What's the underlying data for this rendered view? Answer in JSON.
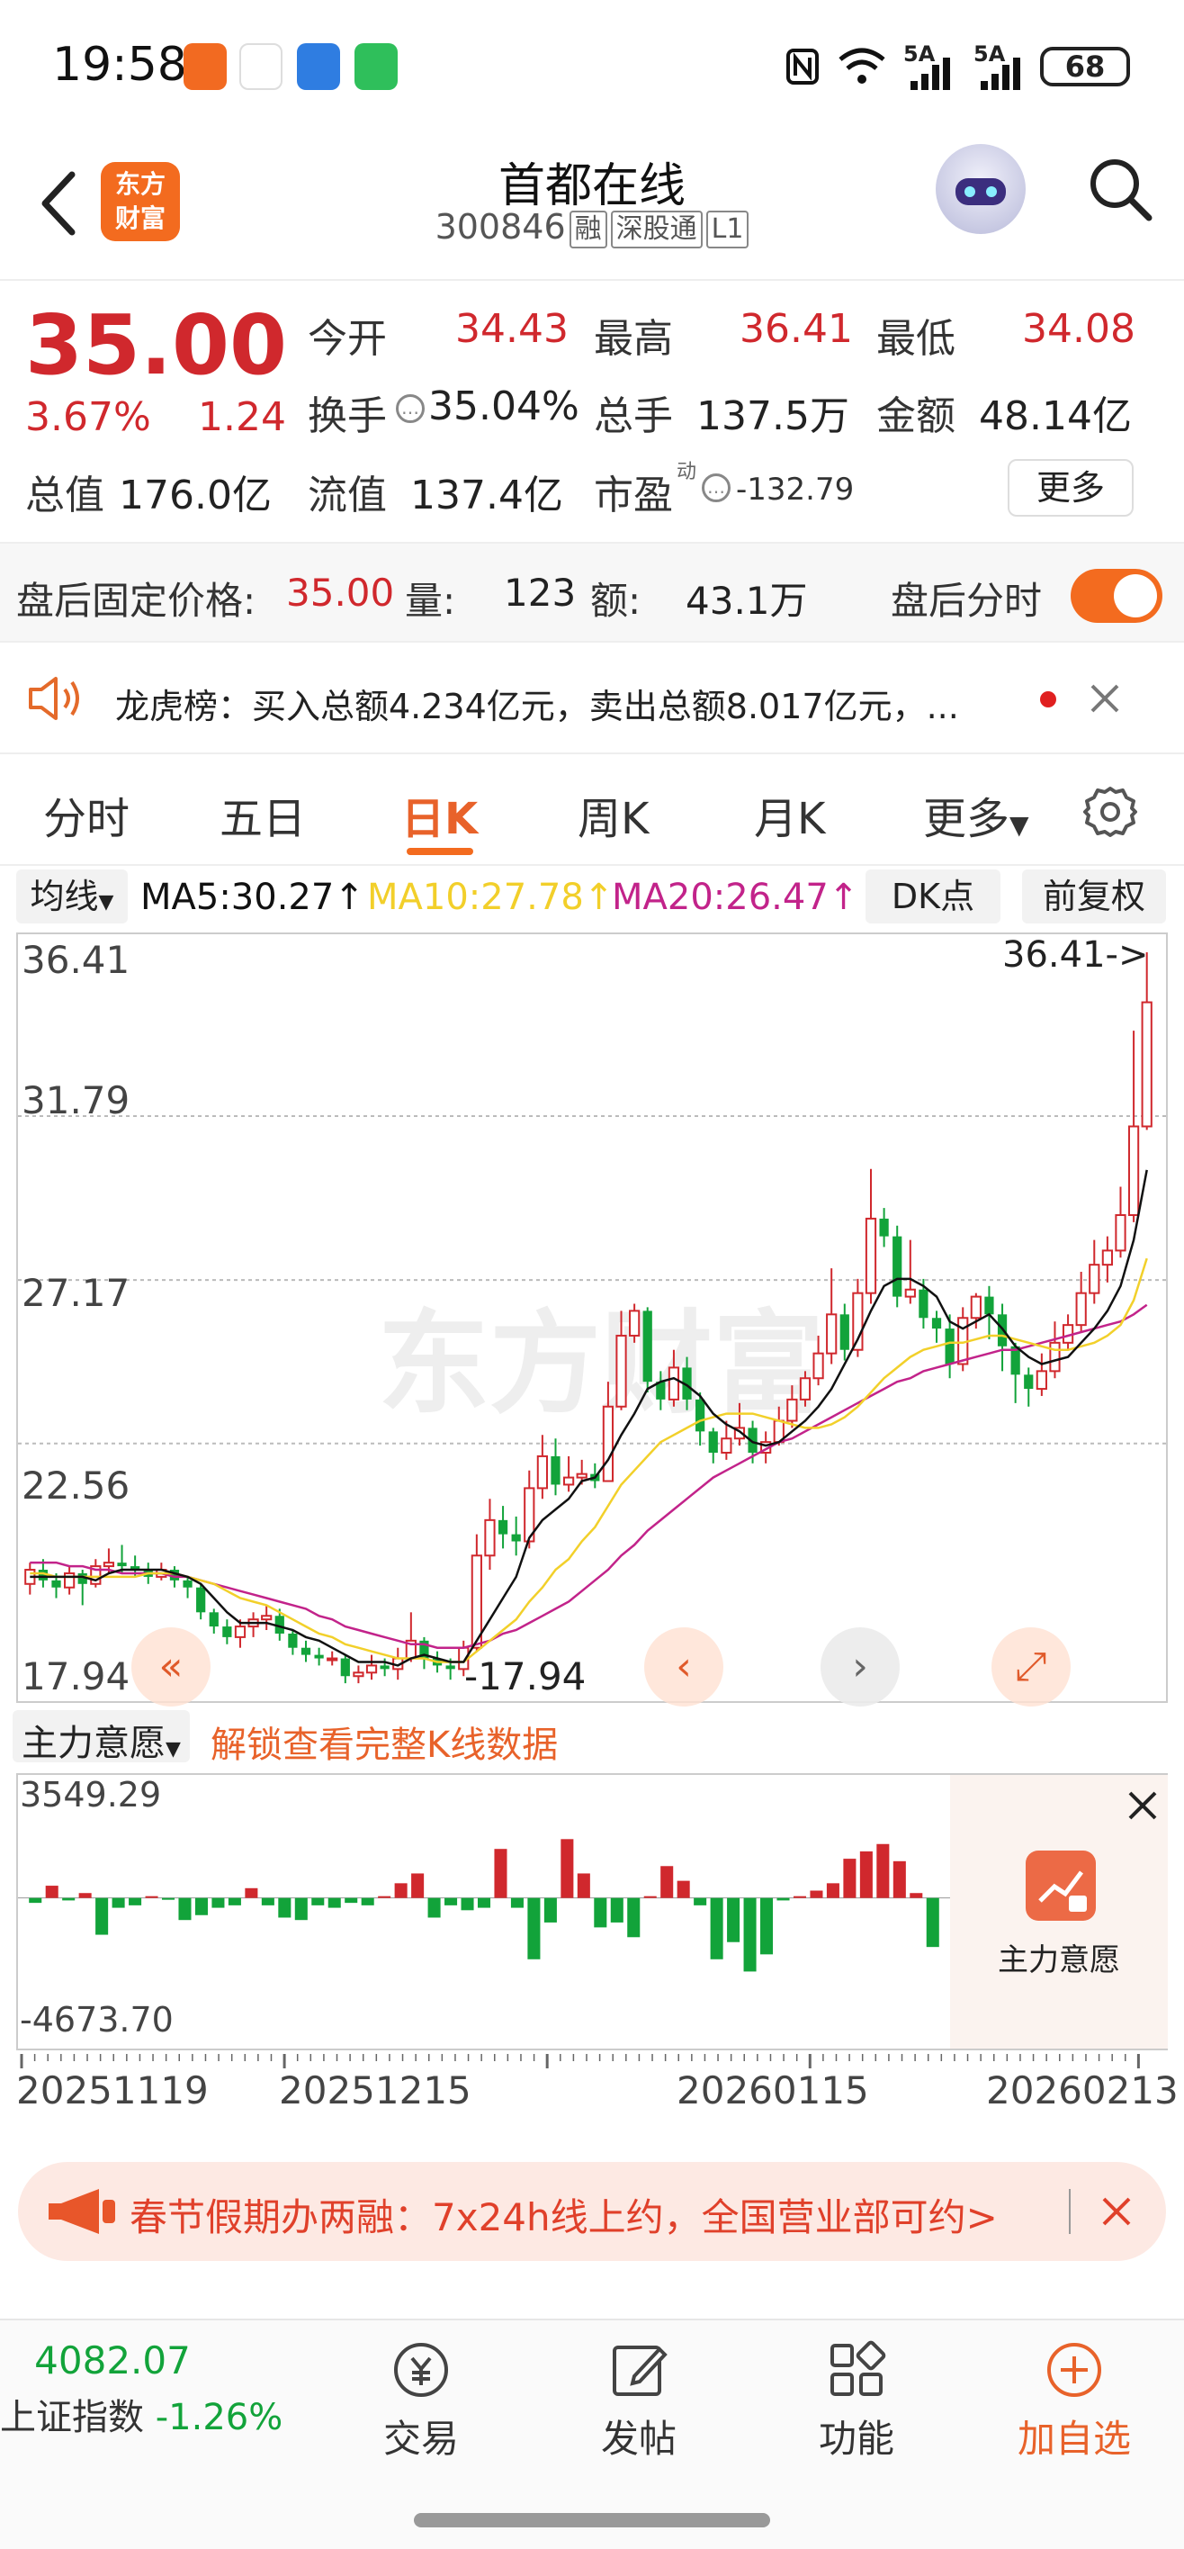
{
  "status": {
    "time": "19:58",
    "network": "5A",
    "battery": "68"
  },
  "header": {
    "logo_line1": "东方",
    "logo_line2": "财富",
    "name": "首都在线",
    "code": "300846",
    "tags": [
      "融",
      "深股通",
      "L1"
    ]
  },
  "quote": {
    "price": "35.00",
    "change_pct": "3.67%",
    "change_amt": "1.24",
    "open_label": "今开",
    "open": "34.43",
    "high_label": "最高",
    "high": "36.41",
    "low_label": "最低",
    "low": "34.08",
    "turnover_label": "换手",
    "turnover": "35.04%",
    "volume_label": "总手",
    "volume": "137.5万",
    "amount_label": "金额",
    "amount": "48.14亿",
    "mcap_label": "总值",
    "mcap": "176.0亿",
    "float_label": "流值",
    "float": "137.4亿",
    "pe_label": "市盈",
    "pe_sup": "动",
    "pe": "-132.79",
    "more_label": "更多"
  },
  "afterhours": {
    "price_label": "盘后固定价格:",
    "price": "35.00",
    "vol_label": "量:",
    "vol": "123",
    "amt_label": "额:",
    "amt": "43.1万",
    "toggle_label": "盘后分时",
    "toggle_on": true
  },
  "notice": {
    "text": "龙虎榜：买入总额4.234亿元，卖出总额8.017亿元，..."
  },
  "tabs": [
    "分时",
    "五日",
    "日K",
    "周K",
    "月K",
    "更多"
  ],
  "active_tab": "日K",
  "ma": {
    "selector": "均线",
    "ma5": "MA5:30.27↑",
    "ma10": "MA10:27.78↑",
    "ma20": "MA20:26.47↑",
    "dk": "DK点",
    "adjust": "前复权",
    "ma5_color": "#111111",
    "ma10_color": "#f2d02a",
    "ma20_color": "#c2238a"
  },
  "kline": {
    "price_labels": [
      "36.41",
      "31.79",
      "27.17",
      "22.56",
      "17.94"
    ],
    "high_marker": "36.41->",
    "low_marker": "-17.94",
    "watermark": "东方财富",
    "up_color": "#d0282d",
    "down_color": "#12a33a",
    "bars": [
      [
        18.6,
        19.0,
        18.3,
        19.2
      ],
      [
        19.0,
        18.7,
        18.5,
        19.3
      ],
      [
        18.7,
        18.5,
        18.2,
        18.9
      ],
      [
        18.5,
        18.9,
        18.3,
        19.1
      ],
      [
        18.9,
        18.6,
        18.0,
        19.0
      ],
      [
        18.6,
        19.1,
        18.5,
        19.3
      ],
      [
        19.1,
        19.2,
        18.9,
        19.6
      ],
      [
        19.2,
        19.1,
        18.9,
        19.7
      ],
      [
        19.1,
        19.0,
        18.8,
        19.4
      ],
      [
        19.0,
        18.8,
        18.6,
        19.2
      ],
      [
        18.8,
        19.0,
        18.7,
        19.2
      ],
      [
        19.0,
        18.7,
        18.5,
        19.1
      ],
      [
        18.7,
        18.5,
        18.2,
        18.8
      ],
      [
        18.5,
        17.8,
        17.6,
        18.6
      ],
      [
        17.8,
        17.4,
        17.2,
        17.9
      ],
      [
        17.4,
        17.1,
        16.9,
        17.6
      ],
      [
        17.1,
        17.4,
        16.8,
        17.6
      ],
      [
        17.4,
        17.6,
        17.1,
        17.8
      ],
      [
        17.6,
        17.7,
        17.3,
        18.0
      ],
      [
        17.7,
        17.2,
        17.0,
        17.9
      ],
      [
        17.2,
        16.8,
        16.6,
        17.3
      ],
      [
        16.8,
        16.6,
        16.4,
        17.0
      ],
      [
        16.6,
        16.5,
        16.3,
        16.8
      ],
      [
        16.5,
        16.5,
        16.3,
        16.7
      ],
      [
        16.5,
        16.0,
        15.8,
        16.6
      ],
      [
        16.0,
        16.1,
        15.8,
        16.3
      ],
      [
        16.1,
        16.3,
        15.9,
        16.6
      ],
      [
        16.3,
        16.2,
        16.0,
        16.5
      ],
      [
        16.2,
        16.5,
        15.9,
        16.8
      ],
      [
        16.5,
        17.0,
        16.4,
        17.8
      ],
      [
        17.0,
        16.5,
        16.2,
        17.1
      ],
      [
        16.5,
        16.3,
        16.1,
        16.7
      ],
      [
        16.3,
        16.2,
        15.9,
        16.5
      ],
      [
        16.2,
        16.8,
        16.0,
        17.0
      ],
      [
        16.8,
        19.4,
        16.7,
        20.0
      ],
      [
        19.4,
        20.4,
        19.0,
        21.0
      ],
      [
        20.4,
        20.0,
        19.6,
        20.8
      ],
      [
        20.0,
        19.8,
        19.4,
        20.5
      ],
      [
        19.8,
        21.3,
        19.6,
        21.8
      ],
      [
        21.3,
        22.2,
        21.0,
        22.8
      ],
      [
        22.2,
        21.4,
        21.1,
        22.7
      ],
      [
        21.4,
        21.6,
        21.2,
        22.2
      ],
      [
        21.6,
        21.7,
        21.4,
        22.1
      ],
      [
        21.7,
        21.5,
        21.3,
        22.0
      ],
      [
        21.5,
        23.6,
        21.5,
        24.3
      ],
      [
        23.6,
        25.6,
        23.5,
        26.3
      ],
      [
        25.6,
        26.3,
        25.4,
        26.5
      ],
      [
        26.3,
        24.3,
        24.0,
        26.4
      ],
      [
        24.3,
        23.8,
        23.5,
        24.6
      ],
      [
        23.8,
        24.7,
        23.6,
        25.2
      ],
      [
        24.7,
        23.8,
        23.5,
        25.0
      ],
      [
        23.8,
        22.9,
        22.5,
        24.0
      ],
      [
        22.9,
        22.3,
        22.0,
        23.0
      ],
      [
        22.3,
        22.7,
        22.1,
        23.2
      ],
      [
        22.7,
        23.0,
        22.5,
        23.7
      ],
      [
        23.0,
        22.3,
        22.0,
        23.2
      ],
      [
        22.3,
        22.6,
        22.0,
        22.9
      ],
      [
        22.6,
        23.2,
        22.5,
        23.6
      ],
      [
        23.2,
        23.8,
        23.0,
        24.2
      ],
      [
        23.8,
        24.4,
        23.6,
        24.6
      ],
      [
        24.4,
        25.1,
        24.2,
        25.6
      ],
      [
        25.1,
        26.2,
        24.8,
        27.5
      ],
      [
        26.2,
        25.2,
        24.9,
        26.5
      ],
      [
        25.2,
        26.8,
        25.0,
        27.2
      ],
      [
        26.8,
        28.9,
        26.5,
        30.3
      ],
      [
        28.9,
        28.4,
        28.1,
        29.2
      ],
      [
        28.4,
        26.7,
        26.4,
        28.7
      ],
      [
        26.7,
        26.9,
        26.5,
        28.3
      ],
      [
        26.9,
        26.1,
        25.8,
        27.2
      ],
      [
        26.1,
        25.8,
        25.4,
        26.3
      ],
      [
        25.8,
        24.8,
        24.4,
        26.2
      ],
      [
        24.8,
        26.1,
        24.6,
        26.4
      ],
      [
        26.1,
        26.7,
        25.8,
        26.8
      ],
      [
        26.7,
        26.2,
        25.5,
        27.0
      ],
      [
        26.2,
        25.3,
        24.6,
        26.5
      ],
      [
        25.3,
        24.5,
        23.7,
        25.4
      ],
      [
        24.5,
        24.1,
        23.6,
        24.7
      ],
      [
        24.1,
        24.6,
        23.9,
        25.1
      ],
      [
        24.6,
        25.4,
        24.4,
        26.0
      ],
      [
        25.4,
        25.9,
        25.2,
        26.2
      ],
      [
        25.9,
        26.8,
        25.7,
        27.4
      ],
      [
        26.8,
        27.6,
        26.5,
        28.3
      ],
      [
        27.6,
        28.0,
        27.1,
        28.4
      ],
      [
        28.0,
        29.0,
        27.8,
        29.8
      ],
      [
        29.0,
        31.5,
        28.8,
        34.2
      ],
      [
        31.5,
        35.0,
        31.4,
        36.41
      ]
    ],
    "ma5": [
      18.8,
      18.8,
      18.8,
      18.8,
      18.8,
      18.7,
      18.9,
      19.0,
      19.0,
      19.0,
      19.0,
      18.9,
      18.8,
      18.6,
      18.2,
      17.8,
      17.5,
      17.5,
      17.5,
      17.4,
      17.3,
      17.1,
      17.0,
      16.8,
      16.6,
      16.4,
      16.4,
      16.4,
      16.3,
      16.5,
      16.6,
      16.5,
      16.4,
      16.4,
      17.0,
      17.6,
      18.2,
      18.8,
      19.9,
      20.4,
      20.7,
      21.0,
      21.5,
      21.6,
      22.1,
      22.8,
      23.4,
      24.1,
      24.3,
      24.4,
      24.2,
      23.9,
      23.4,
      23.1,
      22.9,
      22.6,
      22.5,
      22.6,
      22.9,
      23.2,
      23.6,
      24.1,
      24.8,
      25.5,
      26.3,
      27.0,
      27.2,
      27.2,
      27.0,
      26.7,
      26.0,
      25.8,
      26.0,
      26.2,
      25.8,
      25.3,
      25.0,
      24.8,
      24.9,
      25.0,
      25.4,
      25.8,
      26.3,
      27.0,
      28.3,
      30.27
    ],
    "ma10": [
      18.9,
      18.9,
      18.8,
      18.8,
      18.8,
      18.8,
      18.8,
      18.8,
      18.8,
      18.9,
      18.9,
      18.9,
      18.8,
      18.7,
      18.6,
      18.4,
      18.2,
      18.1,
      18.0,
      17.8,
      17.6,
      17.4,
      17.2,
      17.1,
      16.9,
      16.8,
      16.7,
      16.6,
      16.5,
      16.5,
      16.5,
      16.4,
      16.4,
      16.4,
      16.7,
      17.0,
      17.3,
      17.6,
      18.1,
      18.5,
      19.0,
      19.3,
      19.8,
      20.2,
      20.8,
      21.4,
      21.8,
      22.2,
      22.6,
      22.8,
      23.0,
      23.2,
      23.3,
      23.4,
      23.4,
      23.4,
      23.3,
      23.2,
      23.1,
      23.0,
      23.0,
      23.1,
      23.3,
      23.6,
      24.0,
      24.4,
      24.7,
      25.0,
      25.2,
      25.3,
      25.4,
      25.4,
      25.5,
      25.6,
      25.6,
      25.5,
      25.4,
      25.3,
      25.2,
      25.2,
      25.3,
      25.4,
      25.6,
      25.9,
      26.6,
      27.78
    ],
    "ma20": [
      19.2,
      19.2,
      19.2,
      19.1,
      19.1,
      19.0,
      19.0,
      18.9,
      18.9,
      18.9,
      18.9,
      18.8,
      18.8,
      18.7,
      18.6,
      18.5,
      18.4,
      18.3,
      18.2,
      18.1,
      18.0,
      17.9,
      17.7,
      17.6,
      17.4,
      17.3,
      17.2,
      17.1,
      17.0,
      16.9,
      16.9,
      16.8,
      16.8,
      16.8,
      16.9,
      17.0,
      17.2,
      17.3,
      17.5,
      17.7,
      17.9,
      18.1,
      18.4,
      18.7,
      19.0,
      19.4,
      19.7,
      20.1,
      20.4,
      20.7,
      21.0,
      21.3,
      21.6,
      21.8,
      22.0,
      22.2,
      22.4,
      22.6,
      22.7,
      22.9,
      23.1,
      23.3,
      23.5,
      23.7,
      23.9,
      24.1,
      24.3,
      24.4,
      24.6,
      24.7,
      24.8,
      24.9,
      25.0,
      25.1,
      25.2,
      25.2,
      25.3,
      25.4,
      25.5,
      25.6,
      25.7,
      25.8,
      25.9,
      26.0,
      26.2,
      26.47
    ]
  },
  "mainforce": {
    "selector": "主力意愿",
    "unlock": "解锁查看完整K线数据",
    "top_label": "3549.29",
    "bottom_label": "-4673.70",
    "panel_label": "主力意愿",
    "values": [
      -200,
      500,
      -100,
      200,
      -1500,
      -400,
      -300,
      0,
      -50,
      -900,
      -700,
      -400,
      -300,
      400,
      -300,
      -800,
      -900,
      -300,
      -400,
      -200,
      -300,
      0,
      600,
      1000,
      -800,
      -300,
      -500,
      -400,
      2000,
      -400,
      -2500,
      -1000,
      2400,
      1000,
      -1200,
      -1000,
      -1600,
      0,
      1300,
      700,
      -300,
      -2500,
      -1800,
      -3000,
      -2300,
      -100,
      0,
      300,
      600,
      1600,
      1900,
      2200,
      1500,
      200,
      -2000
    ]
  },
  "dates": [
    "20251119",
    "20251215",
    "20260115",
    "20260213"
  ],
  "banner": {
    "text": "春节假期办两融：7x24h线上约，全国营业部可约>"
  },
  "bottom": {
    "index_value": "4082.07",
    "index_name": "上证指数",
    "index_change": "-1.26%",
    "items": [
      "交易",
      "发帖",
      "功能",
      "加自选"
    ]
  }
}
